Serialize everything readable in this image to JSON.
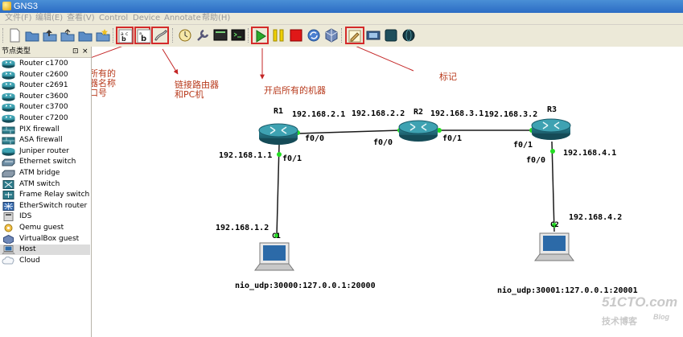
{
  "window": {
    "title": "GNS3"
  },
  "menu": [
    "文件(F)",
    "编辑(E)",
    "查看(V)",
    "Control",
    "Device",
    "Annotate",
    "帮助(H)"
  ],
  "toolbar": {
    "buttons": [
      "new-document-icon",
      "open-folder-icon",
      "save-project-icon",
      "export-icon",
      "open-project-icon",
      "snapshot-icon",
      "show-hostnames-icon",
      "show-interface-names-icon",
      "add-link-icon",
      "console-clock-icon",
      "wrench-icon",
      "console-icon",
      "terminal-icon",
      "start-all-icon",
      "suspend-all-icon",
      "stop-all-icon",
      "reload-icon",
      "virtualbox-icon",
      "add-note-icon",
      "screenshot-icon",
      "dark-square-icon",
      "globe-icon"
    ]
  },
  "panel": {
    "title": "节点类型",
    "pin_glyph": "⊡",
    "close_glyph": "×",
    "items": [
      {
        "label": "Router c1700",
        "icon": "router-icon"
      },
      {
        "label": "Router c2600",
        "icon": "router-icon"
      },
      {
        "label": "Router c2691",
        "icon": "router-icon"
      },
      {
        "label": "Router c3600",
        "icon": "router-icon"
      },
      {
        "label": "Router c3700",
        "icon": "router-icon"
      },
      {
        "label": "Router c7200",
        "icon": "router-icon"
      },
      {
        "label": "PIX firewall",
        "icon": "firewall-icon"
      },
      {
        "label": "ASA firewall",
        "icon": "firewall-icon"
      },
      {
        "label": "Juniper router",
        "icon": "juniper-router-icon"
      },
      {
        "label": "Ethernet switch",
        "icon": "ethernet-switch-icon"
      },
      {
        "label": "ATM bridge",
        "icon": "atm-bridge-icon"
      },
      {
        "label": "ATM switch",
        "icon": "atm-switch-icon"
      },
      {
        "label": "Frame Relay switch",
        "icon": "frame-relay-switch-icon"
      },
      {
        "label": "EtherSwitch router",
        "icon": "etherswitch-router-icon"
      },
      {
        "label": "IDS",
        "icon": "ids-icon"
      },
      {
        "label": "Qemu guest",
        "icon": "qemu-guest-icon"
      },
      {
        "label": "VirtualBox guest",
        "icon": "virtualbox-guest-icon"
      },
      {
        "label": "Host",
        "icon": "host-icon",
        "selected": true
      },
      {
        "label": "Cloud",
        "icon": "cloud-icon"
      }
    ]
  },
  "annotations": {
    "show_names": "开启所有的\n路由器名称\n和端口号",
    "add_link": "链接路由器\n和PC机",
    "start_all": "开启所有的机器",
    "note": "标记"
  },
  "topology": {
    "routers": [
      {
        "name": "R1"
      },
      {
        "name": "R2"
      },
      {
        "name": "R3"
      }
    ],
    "hosts": [
      {
        "name": "C1",
        "nio": "nio_udp:30000:127.0.0.1:20000"
      },
      {
        "name": "C2",
        "nio": "nio_udp:30001:127.0.0.1:20001"
      }
    ],
    "labels": {
      "r1_left_ip": "192.168.2.1",
      "r2_left_ip": "192.168.2.2",
      "r2_right_ip": "192.168.3.1",
      "r3_left_ip": "192.168.3.2",
      "r1_down_ip": "192.168.1.1",
      "r3_down_ip": "192.168.4.1",
      "c1_ip": "192.168.1.2",
      "c2_ip": "192.168.4.2",
      "r1_f00": "f0/0",
      "r2_f00": "f0/0",
      "r2_f01": "f0/1",
      "r3_f01": "f0/1",
      "r1_f01": "f0/1",
      "r3_f00": "f0/0"
    },
    "link_color": "#1a1a1a",
    "port_color": "#22dd22"
  },
  "watermark": {
    "site": "51CTO.com",
    "sub": "技术博客",
    "blog": "Blog"
  }
}
